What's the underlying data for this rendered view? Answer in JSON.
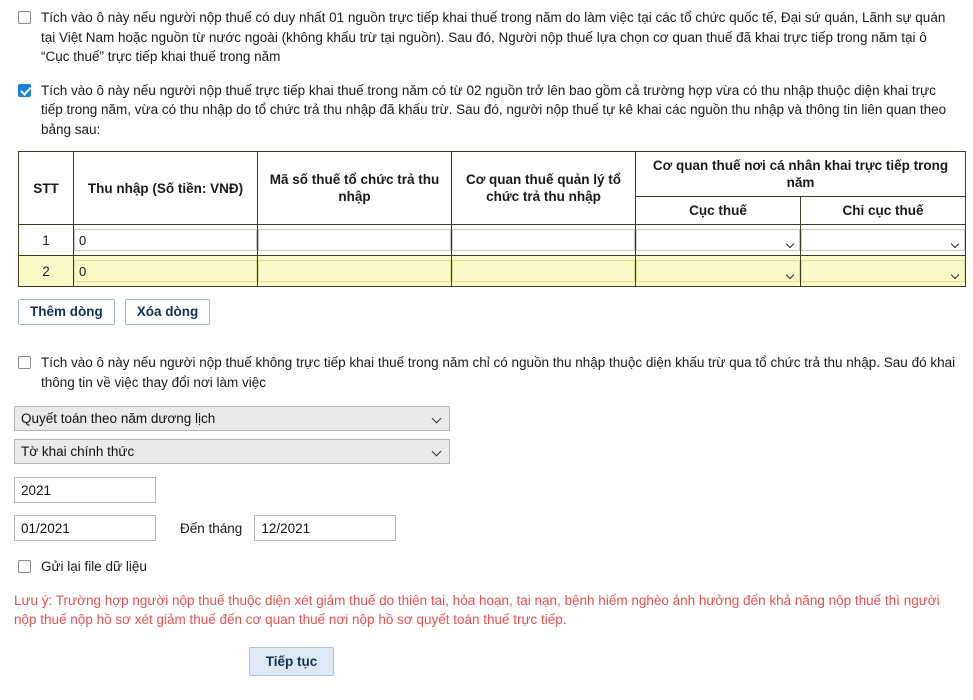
{
  "options": [
    {
      "id": "single-source",
      "checked": false,
      "text": "Tích vào ô này nếu người nộp thuế có duy nhất 01 nguồn trực tiếp khai thuế trong năm do làm việc tại các tổ chức quốc tế, Đại sứ quán, Lãnh sự quán tại Việt Nam hoặc nguồn từ nước ngoài (không khấu trừ tại nguồn). Sau đó, Người nộp thuế lựa chọn cơ quan thuế đã khai trực tiếp trong năm tại ô “Cục thuế” trực tiếp khai thuế trong năm"
    },
    {
      "id": "multi-source",
      "checked": true,
      "text": "Tích vào ô này nếu người nộp thuế trực tiếp khai thuế trong năm có từ 02 nguồn trở lên bao gồm cả trường hợp vừa có thu nhập thuộc diện khai trực tiếp trong năm, vừa có thu nhập do tổ chức trả thu nhập đã khấu trừ. Sau đó, người nộp thuế tự kê khai các nguồn thu nhập và thông tin liên quan theo bảng sau:"
    },
    {
      "id": "no-direct-declaration",
      "checked": false,
      "text": "Tích vào ô này nếu người nộp thuế không trực tiếp khai thuế trong năm chỉ có nguồn thu nhập thuộc diện khấu trừ qua tổ chức trả thu nhập. Sau đó khai thông tin về việc thay đổi nơi làm việc"
    }
  ],
  "table": {
    "headers": {
      "stt": "STT",
      "income": "Thu nhập (Số tiền: VNĐ)",
      "tax_code": "Mã số thuế tổ chức trả thu nhập",
      "managing_agency": "Cơ quan thuế quản lý tổ chức trả thu nhập",
      "direct_agency_group": "Cơ quan thuế nơi cá nhân khai trực tiếp trong năm",
      "department": "Cục thuế",
      "sub_department": "Chi cục thuế"
    },
    "rows": [
      {
        "stt": "1",
        "income": "0",
        "tax_code": "",
        "managing_agency": "",
        "department": "",
        "sub_department": "",
        "highlighted": false
      },
      {
        "stt": "2",
        "income": "0",
        "tax_code": "",
        "managing_agency": "",
        "department": "",
        "sub_department": "",
        "highlighted": true
      }
    ],
    "add_row_label": "Thêm dòng",
    "delete_row_label": "Xóa dòng"
  },
  "settlement": {
    "period_type": "Quyết toán theo năm dương lịch",
    "declaration_type": "Tờ khai chính thức",
    "year": "2021",
    "from_month": "01/2021",
    "to_month_label": "Đến tháng",
    "to_month": "12/2021"
  },
  "resend": {
    "label": "Gửi lại file dữ liệu",
    "checked": false
  },
  "note": "Lưu ý: Trường hợp người nộp thuế thuộc diện xét giảm thuế do thiên tai, hỏa hoạn, tai nạn, bệnh hiểm nghèo ảnh hưởng đến khả năng nộp thuế thì người nộp thuế nộp hồ sơ xét giảm thuế đến cơ quan thuế nơi nộp hồ sơ quyết toán thuế trực tiếp.",
  "footer": {
    "continue_label": "Tiếp tục"
  },
  "colors": {
    "accent": "#1b7fe0",
    "note": "#e8504f",
    "row_highlight": "#fafac8",
    "primary_button_bg": "#dceaf7"
  }
}
